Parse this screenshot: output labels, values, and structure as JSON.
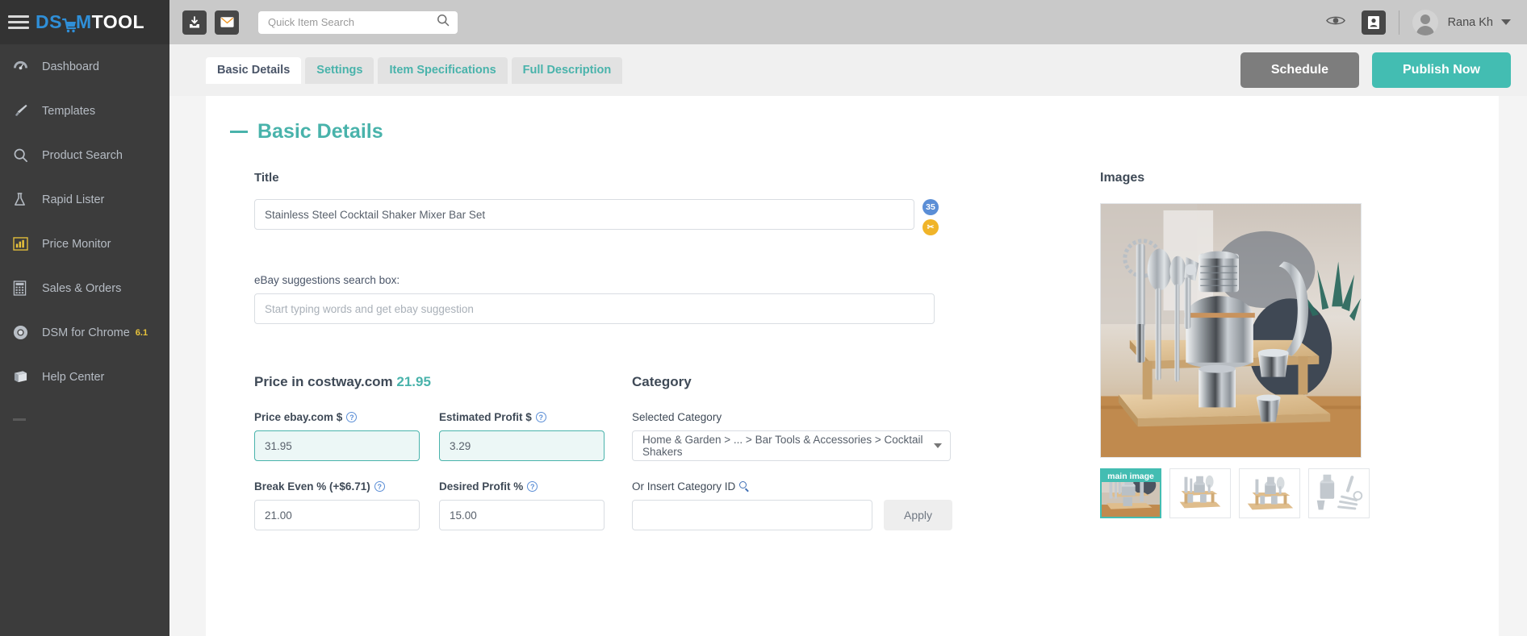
{
  "app": {
    "logo_dsm": "DS",
    "logo_m": "M",
    "logo_tool": "TOOL"
  },
  "sidebar": {
    "items": [
      {
        "label": "Dashboard",
        "icon": "dashboard-icon",
        "badge": ""
      },
      {
        "label": "Templates",
        "icon": "brush-icon",
        "badge": ""
      },
      {
        "label": "Product Search",
        "icon": "search-icon",
        "badge": ""
      },
      {
        "label": "Rapid Lister",
        "icon": "flask-icon",
        "badge": ""
      },
      {
        "label": "Price Monitor",
        "icon": "bar-chart-icon",
        "badge": ""
      },
      {
        "label": "Sales & Orders",
        "icon": "calculator-icon",
        "badge": ""
      },
      {
        "label": "DSM for Chrome",
        "icon": "chrome-icon",
        "badge": "6.1"
      },
      {
        "label": "Help Center",
        "icon": "book-icon",
        "badge": ""
      }
    ]
  },
  "topbar": {
    "import_icon": "download-inbox-icon",
    "messages_icon": "envelope-icon",
    "search": {
      "placeholder": "Quick Item Search",
      "value": "",
      "icon": "search-icon"
    },
    "preview_icon": "eye-icon",
    "contact_icon": "address-card-icon",
    "user": {
      "name": "Rana Kh",
      "avatar": "user-avatar",
      "caret": "chevron-down-icon"
    }
  },
  "tabs": [
    {
      "label": "Basic Details",
      "active": true
    },
    {
      "label": "Settings",
      "active": false
    },
    {
      "label": "Item Specifications",
      "active": false
    },
    {
      "label": "Full Description",
      "active": false
    }
  ],
  "actions": {
    "schedule": "Schedule",
    "publish": "Publish Now",
    "schedule_color": "#7d7d7d",
    "publish_color": "#43bdb2"
  },
  "main": {
    "section_title": "Basic Details",
    "accent_color": "#49b3ab",
    "title": {
      "label": "Title",
      "value": "Stainless Steel Cocktail Shaker Mixer Bar Set",
      "char_badge": "35",
      "char_badge_color": "#5b8ed6",
      "scissors_badge": "✂",
      "scissors_badge_color": "#f0b429"
    },
    "ebay_suggestions": {
      "label": "eBay suggestions search box:",
      "placeholder": "Start typing words and get ebay suggestion",
      "value": ""
    },
    "price": {
      "heading_prefix": "Price in costway.com",
      "heading_amount": "21.95",
      "fields": [
        {
          "label": "Price ebay.com $",
          "value": "31.95",
          "help": "?",
          "focused": true
        },
        {
          "label": "Estimated Profit $",
          "value": "3.29",
          "help": "?",
          "focused": true
        },
        {
          "label": "Break Even % (+$6.71)",
          "value": "21.00",
          "help": "?",
          "focused": false
        },
        {
          "label": "Desired Profit %",
          "value": "15.00",
          "help": "?",
          "focused": false
        }
      ]
    },
    "category": {
      "heading": "Category",
      "selected_label": "Selected Category",
      "selected_value": "Home & Garden > ... > Bar Tools & Accessories > Cocktail Shakers",
      "insert_id_label": "Or Insert Category ID",
      "insert_id_icon": "search-icon",
      "insert_id_value": "",
      "apply_label": "Apply"
    },
    "images": {
      "heading": "Images",
      "main_tag": "main image",
      "thumbs": [
        {
          "name": "cocktail-set-lifestyle",
          "main": true
        },
        {
          "name": "cocktail-set-white-1",
          "main": false
        },
        {
          "name": "cocktail-set-white-2",
          "main": false
        },
        {
          "name": "cocktail-tools-flatlay",
          "main": false
        }
      ]
    }
  }
}
